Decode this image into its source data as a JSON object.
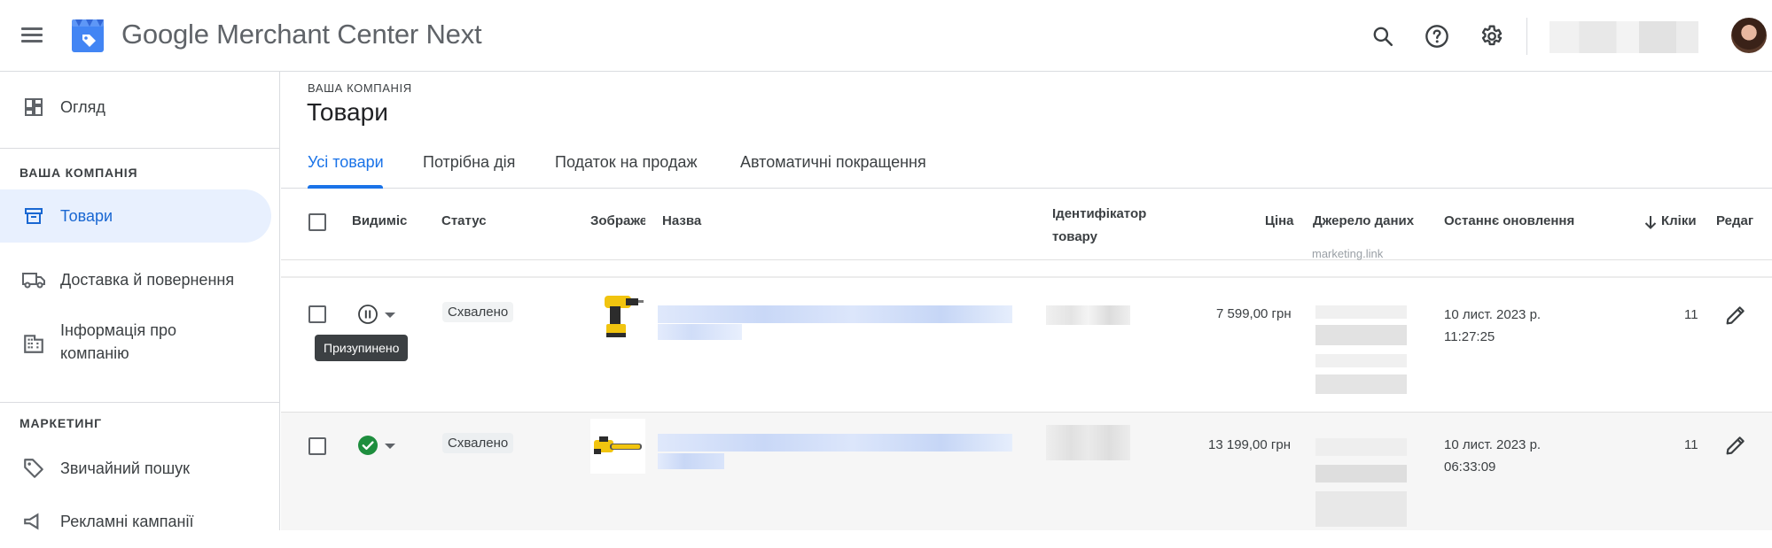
{
  "header": {
    "app_title_google": "Google",
    "app_title_rest": " Merchant Center Next",
    "icons": [
      "menu-icon",
      "search-icon",
      "help-icon",
      "settings-icon"
    ],
    "brand_color": "#4285f4"
  },
  "sidebar": {
    "overview_label": "Огляд",
    "section_company": "ВАША КОМПАНІЯ",
    "products_label": "Товари",
    "shipping_label": "Доставка й повернення",
    "business_info_label": "Інформація про компанію",
    "section_marketing": "МАРКЕТИНГ",
    "free_listings_label": "Звичайний пошук",
    "ads_label": "Рекламні кампанії"
  },
  "main": {
    "breadcrumb": "ВАША КОМПАНІЯ",
    "title": "Товари",
    "tabs": [
      {
        "label": "Усі товари",
        "active": true
      },
      {
        "label": "Потрібна дія",
        "active": false
      },
      {
        "label": "Податок на продаж",
        "active": false
      },
      {
        "label": "Автоматичні покращення",
        "active": false
      }
    ]
  },
  "table": {
    "columns": {
      "visibility": "Видиміс",
      "status": "Статус",
      "image": "Зображе",
      "name": "Назва",
      "id": "Ідентифікатор товару",
      "price": "Ціна",
      "source": "Джерело даних",
      "updated": "Останнє оновлення",
      "clicks": "Кліки",
      "edit": "Редаг"
    },
    "ghost_text": "marketing.link",
    "rows": [
      {
        "visibility": "paused",
        "tooltip": "Призупинено",
        "status": "Схвалено",
        "price": "7 599,00 грн",
        "updated_date": "10 лист. 2023 р.",
        "updated_time": "11:27:25",
        "clicks": "11"
      },
      {
        "visibility": "active",
        "status": "Схвалено",
        "price": "13 199,00 грн",
        "updated_date": "10 лист. 2023 р.",
        "updated_time": "06:33:09",
        "clicks": "11"
      }
    ]
  },
  "colors": {
    "accent": "#1a73e8",
    "active_nav_bg": "#e8f0fe",
    "success": "#1e8e3e",
    "tooltip_bg": "#3c4043"
  }
}
